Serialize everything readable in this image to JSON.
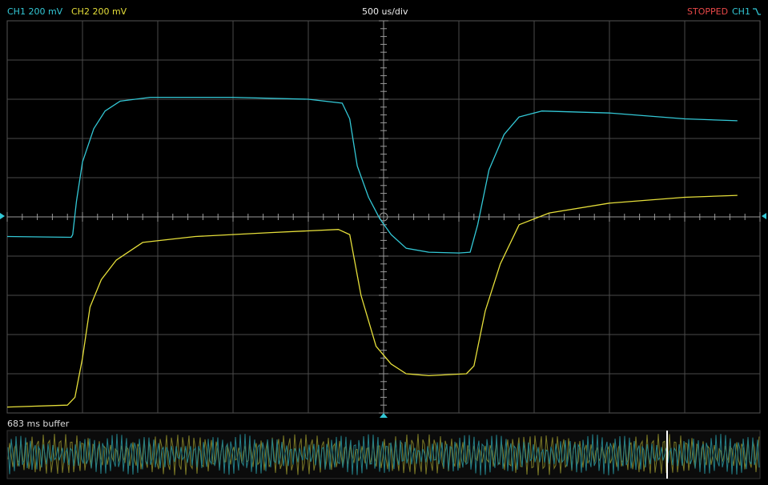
{
  "header": {
    "ch1_label": "CH1 200 mV",
    "ch2_label": "CH2 200 mV",
    "timebase": "500 us/div",
    "status": "STOPPED",
    "trigger_source": "CH1"
  },
  "buffer": {
    "label": "683 ms buffer"
  },
  "colors": {
    "ch1": "#33c8d6",
    "ch2": "#e6df3a",
    "status": "#e84848",
    "grid": "#4a4a4a",
    "axis": "#9a9a9a"
  },
  "chart_data": {
    "type": "line",
    "xlabel": "",
    "ylabel": "",
    "x_divisions": 10,
    "y_divisions": 10,
    "grid": true,
    "series": [
      {
        "name": "CH1",
        "points": [
          [
            0.0,
            -0.5
          ],
          [
            0.85,
            -0.52
          ],
          [
            0.87,
            -0.45
          ],
          [
            0.92,
            0.4
          ],
          [
            1.0,
            1.4
          ],
          [
            1.15,
            2.25
          ],
          [
            1.3,
            2.7
          ],
          [
            1.5,
            2.95
          ],
          [
            1.9,
            3.05
          ],
          [
            3.0,
            3.05
          ],
          [
            4.0,
            3.0
          ],
          [
            4.45,
            2.9
          ],
          [
            4.55,
            2.5
          ],
          [
            4.65,
            1.3
          ],
          [
            4.8,
            0.5
          ],
          [
            4.95,
            -0.05
          ],
          [
            5.1,
            -0.45
          ],
          [
            5.3,
            -0.8
          ],
          [
            5.6,
            -0.9
          ],
          [
            6.0,
            -0.92
          ],
          [
            6.15,
            -0.9
          ],
          [
            6.25,
            -0.2
          ],
          [
            6.4,
            1.2
          ],
          [
            6.6,
            2.1
          ],
          [
            6.8,
            2.55
          ],
          [
            7.1,
            2.7
          ],
          [
            8.0,
            2.65
          ],
          [
            9.0,
            2.5
          ],
          [
            9.7,
            2.45
          ]
        ]
      },
      {
        "name": "CH2",
        "points": [
          [
            0.0,
            -4.85
          ],
          [
            0.8,
            -4.8
          ],
          [
            0.9,
            -4.6
          ],
          [
            1.0,
            -3.6
          ],
          [
            1.1,
            -2.3
          ],
          [
            1.25,
            -1.6
          ],
          [
            1.45,
            -1.1
          ],
          [
            1.8,
            -0.65
          ],
          [
            2.5,
            -0.5
          ],
          [
            3.5,
            -0.4
          ],
          [
            4.4,
            -0.32
          ],
          [
            4.55,
            -0.45
          ],
          [
            4.7,
            -2.0
          ],
          [
            4.9,
            -3.3
          ],
          [
            5.1,
            -3.75
          ],
          [
            5.3,
            -4.0
          ],
          [
            5.6,
            -4.05
          ],
          [
            6.1,
            -4.0
          ],
          [
            6.2,
            -3.8
          ],
          [
            6.35,
            -2.4
          ],
          [
            6.55,
            -1.2
          ],
          [
            6.8,
            -0.2
          ],
          [
            7.2,
            0.1
          ],
          [
            8.0,
            0.35
          ],
          [
            9.0,
            0.5
          ],
          [
            9.7,
            0.55
          ]
        ]
      }
    ]
  }
}
